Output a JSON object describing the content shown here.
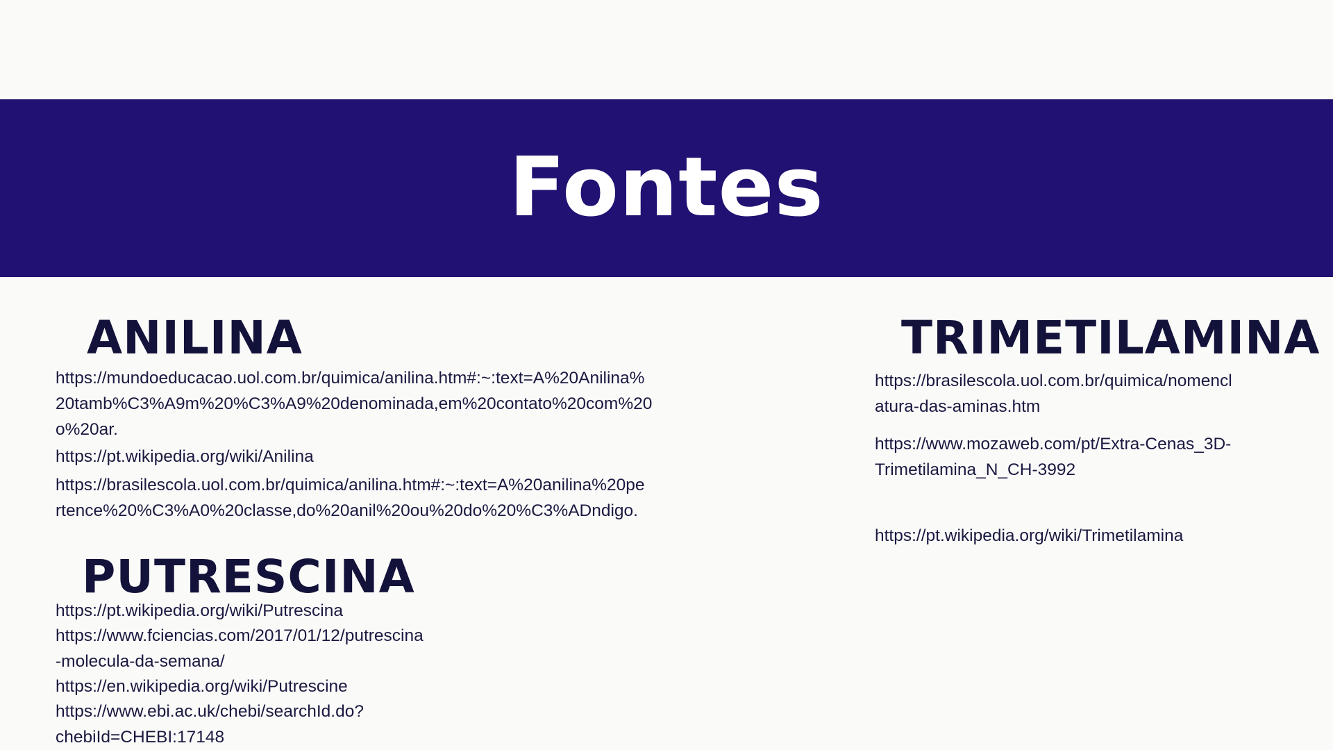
{
  "title": "Fontes",
  "sections": {
    "anilina": {
      "heading": "ANILINA",
      "links": [
        [
          "https://mundoeducacao.uol.com.br/quimica/anilina.htm#:~:text=A%20Anilina%",
          "20tamb%C3%A9m%20%C3%A9%20denominada,em%20contato%20com%20",
          "o%20ar."
        ],
        [
          "https://pt.wikipedia.org/wiki/Anilina"
        ],
        [
          "https://brasilescola.uol.com.br/quimica/anilina.htm#:~:text=A%20anilina%20pe",
          "rtence%20%C3%A0%20classe,do%20anil%20ou%20do%20%C3%ADndigo."
        ]
      ]
    },
    "putrescina": {
      "heading": "PUTRESCINA",
      "links": [
        [
          "https://pt.wikipedia.org/wiki/Putrescina"
        ],
        [
          "https://www.fciencias.com/2017/01/12/putrescina",
          "-molecula-da-semana/"
        ],
        [
          "https://en.wikipedia.org/wiki/Putrescine"
        ],
        [
          "https://www.ebi.ac.uk/chebi/searchId.do?",
          "chebiId=CHEBI:17148"
        ]
      ]
    },
    "trimetilamina": {
      "heading": "TRIMETILAMINA",
      "links": [
        [
          "https://brasilescola.uol.com.br/quimica/nomencl",
          "atura-das-aminas.htm"
        ],
        [
          "https://www.mozaweb.com/pt/Extra-Cenas_3D-",
          "Trimetilamina_N_CH-3992"
        ],
        [
          "https://pt.wikipedia.org/wiki/Trimetilamina"
        ]
      ]
    }
  }
}
